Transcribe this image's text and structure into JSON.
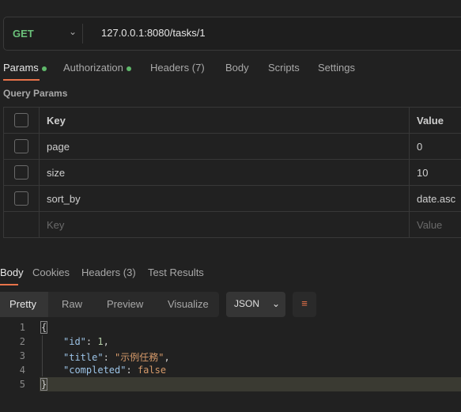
{
  "request": {
    "method": "GET",
    "url": "127.0.0.1:8080/tasks/1"
  },
  "tabs": [
    {
      "label": "Params"
    },
    {
      "label": "Authorization"
    },
    {
      "label": "Headers",
      "count": "(7)"
    },
    {
      "label": "Body"
    },
    {
      "label": "Scripts"
    },
    {
      "label": "Settings"
    }
  ],
  "query_params": {
    "title": "Query Params",
    "headers": {
      "key": "Key",
      "value": "Value"
    },
    "rows": [
      {
        "key": "page",
        "value": "0"
      },
      {
        "key": "size",
        "value": "10"
      },
      {
        "key": "sort_by",
        "value": "date.asc"
      }
    ],
    "placeholder": {
      "key": "Key",
      "value": "Value"
    }
  },
  "response_tabs": [
    {
      "label": "Body"
    },
    {
      "label": "Cookies"
    },
    {
      "label": "Headers",
      "count": "(3)"
    },
    {
      "label": "Test Results"
    }
  ],
  "view_modes": [
    "Pretty",
    "Raw",
    "Preview",
    "Visualize"
  ],
  "format": "JSON",
  "code": {
    "lines": [
      "1",
      "2",
      "3",
      "4",
      "5"
    ],
    "open": "{",
    "close": "}",
    "id_key": "\"id\"",
    "id_val": "1",
    "title_key": "\"title\"",
    "title_val": "\"示例任務\"",
    "completed_key": "\"completed\"",
    "completed_val": "false"
  }
}
